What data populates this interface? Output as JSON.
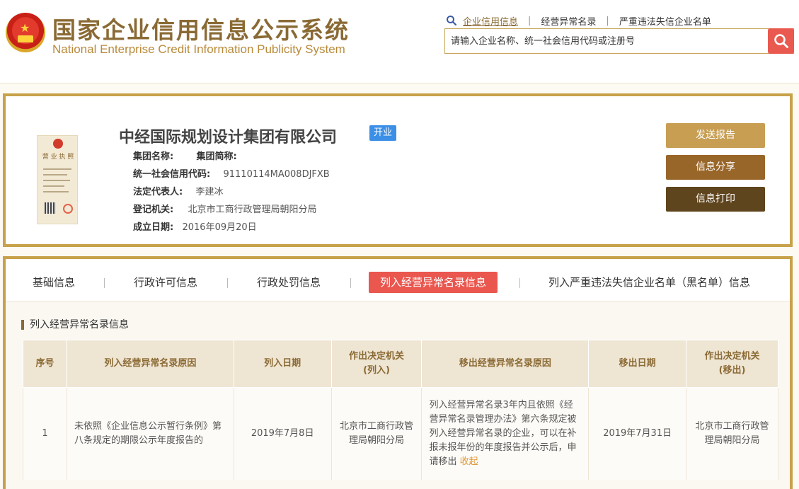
{
  "header": {
    "title": "国家企业信用信息公示系统",
    "subtitle": "National Enterprise Credit Information Publicity System",
    "nav": [
      "企业信用信息",
      "经营异常名录",
      "严重违法失信企业名单"
    ],
    "search_placeholder": "请输入企业名称、统一社会信用代码或注册号"
  },
  "company": {
    "name": "中经国际规划设计集团有限公司",
    "status": "开业",
    "license_title": "营 业 执 照",
    "group_name_label": "集团名称:",
    "group_short_label": "集团简称:",
    "credit_code_label": "统一社会信用代码:",
    "credit_code": "91110114MA008DJFXB",
    "legal_rep_label": "法定代表人:",
    "legal_rep": "李建冰",
    "reg_authority_label": "登记机关:",
    "reg_authority": "北京市工商行政管理局朝阳分局",
    "established_label": "成立日期:",
    "established": "2016年09月20日"
  },
  "actions": {
    "report": "发送报告",
    "share": "信息分享",
    "print": "信息打印"
  },
  "tabs": [
    "基础信息",
    "行政许可信息",
    "行政处罚信息",
    "列入经营异常名录信息",
    "列入严重违法失信企业名单（黑名单）信息"
  ],
  "active_tab_index": 3,
  "section_title": "列入经营异常名录信息",
  "table": {
    "headers": [
      "序号",
      "列入经营异常名录原因",
      "列入日期",
      "作出决定机关\n(列入)",
      "移出经营异常名录原因",
      "移出日期",
      "作出决定机关\n(移出)"
    ],
    "rows": [
      {
        "index": "1",
        "reason": "未依照《企业信息公示暂行条例》第八条规定的期限公示年度报告的",
        "date_in": "2019年7月8日",
        "authority_in": "北京市工商行政管理局朝阳分局",
        "removal_reason": "列入经营异常名录3年内且依照《经营异常名录管理办法》第六条规定被列入经营异常名录的企业，可以在补报未报年份的年度报告并公示后，申请移出",
        "collapse": "收起",
        "date_out": "2019年7月31日",
        "authority_out": "北京市工商行政管理局朝阳分局"
      }
    ]
  },
  "colors": {
    "gold_border": "#c8a24a",
    "brand_brown": "#8a6a34",
    "active_tab": "#e9574f",
    "badge_blue": "#3b8fe6",
    "btn_report": "#c79e52",
    "btn_share": "#99662a",
    "btn_print": "#5f451d"
  },
  "icons": {
    "nav": "search-icon",
    "search_button": "search-icon"
  }
}
